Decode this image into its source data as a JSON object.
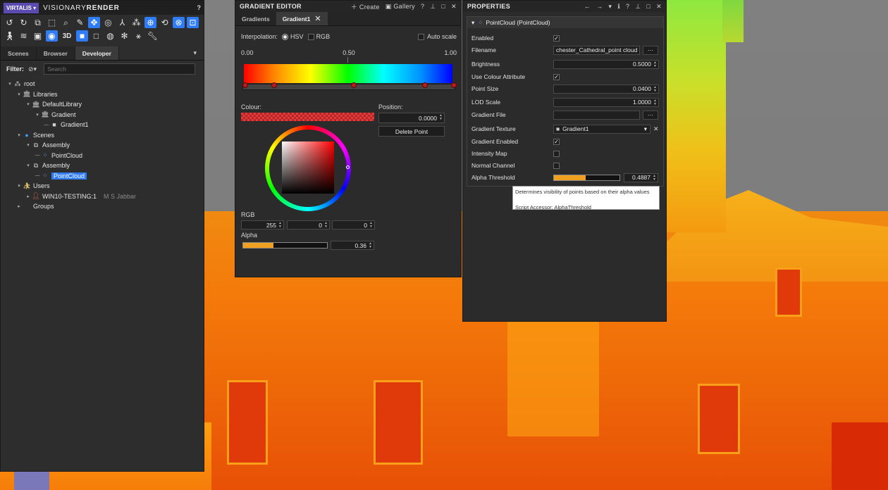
{
  "app": {
    "logo": "VIRTALIS",
    "name_light": "VISIONARY",
    "name_bold": "RENDER",
    "help": "?"
  },
  "left_panel": {
    "toolbar_row1": [
      "undo-icon",
      "redo-icon",
      "copy-icon",
      "select-icon",
      "zoom-icon",
      "edit-icon",
      "move-icon",
      "globe-icon",
      "axis-icon",
      "nodes-icon",
      "orbit-icon",
      "walk-icon",
      "magnet-icon",
      "snap-icon"
    ],
    "toolbar_row2": [
      "person-icon",
      "wifi-icon",
      "image-icon",
      "bulb-icon",
      "3d-toggle",
      "solid-icon",
      "wire-icon",
      "sphere-icon",
      "cog-icon",
      "pose-icon",
      "wrench-icon"
    ],
    "label_3d": "3D",
    "tabs": [
      {
        "label": "Scenes"
      },
      {
        "label": "Browser"
      },
      {
        "label": "Developer"
      }
    ],
    "tabs_more": "▾",
    "filter_label": "Filter:",
    "search_placeholder": "Search",
    "tree": [
      {
        "label": "root",
        "depth": 0,
        "icon": "root"
      },
      {
        "label": "Libraries",
        "depth": 1,
        "icon": "library"
      },
      {
        "label": "DefaultLibrary",
        "depth": 2,
        "icon": "library"
      },
      {
        "label": "Gradient",
        "depth": 3,
        "icon": "library"
      },
      {
        "label": "Gradient1",
        "depth": 4,
        "icon": "gradient"
      },
      {
        "label": "Scenes",
        "depth": 1,
        "icon": "scene"
      },
      {
        "label": "Assembly",
        "depth": 2,
        "icon": "assembly"
      },
      {
        "label": "PointCloud",
        "depth": 3,
        "icon": "pointcloud"
      },
      {
        "label": "Assembly",
        "depth": 2,
        "icon": "assembly"
      },
      {
        "label": "PointCloud",
        "depth": 3,
        "icon": "pointcloud",
        "selected": true
      },
      {
        "label": "Users",
        "depth": 1,
        "icon": "users"
      },
      {
        "label": "WIN10-TESTING:1",
        "depth": 2,
        "icon": "user",
        "sub": "M S Jabbar"
      },
      {
        "label": "Groups",
        "depth": 1,
        "icon": "groups"
      }
    ]
  },
  "gradient_editor": {
    "title": "GRADIENT EDITOR",
    "create": "Create",
    "gallery": "Gallery",
    "tabs": [
      "Gradients",
      "Gradient1"
    ],
    "interpolation_label": "Interpolation:",
    "hsv": "HSV",
    "rgb": "RGB",
    "auto_scale": "Auto scale",
    "scale": [
      "0.00",
      "0.50",
      "1.00"
    ],
    "stops": [
      0.0,
      0.14,
      0.52,
      0.86,
      1.0
    ],
    "colour_label": "Colour:",
    "position_label": "Position:",
    "position_value": "0.0000",
    "delete_point": "Delete Point",
    "rgb_label": "RGB",
    "rgb_values": [
      "255",
      "0",
      "0"
    ],
    "alpha_label": "Alpha",
    "alpha_value": "0.36",
    "alpha_fraction": 0.36
  },
  "properties": {
    "title": "PROPERTIES",
    "section": "PointCloud (PointCloud)",
    "rows": [
      {
        "name": "Enabled",
        "type": "check",
        "checked": true
      },
      {
        "name": "Filename",
        "type": "file",
        "value": "chester_Cathedral_point cloud"
      },
      {
        "name": "Brightness",
        "type": "number",
        "value": "0.5000"
      },
      {
        "name": "Use Colour Attribute",
        "type": "check",
        "checked": true
      },
      {
        "name": "Point Size",
        "type": "number",
        "value": "0.0400"
      },
      {
        "name": "LOD Scale",
        "type": "number",
        "value": "1.0000"
      },
      {
        "name": "Gradient File",
        "type": "file",
        "value": ""
      },
      {
        "name": "Gradient Texture",
        "type": "select",
        "value": "Gradient1"
      },
      {
        "name": "Gradient Enabled",
        "type": "check",
        "checked": true
      },
      {
        "name": "Intensity Map",
        "type": "check",
        "checked": false
      },
      {
        "name": "Normal Channel",
        "type": "check",
        "checked": false
      },
      {
        "name": "Alpha Threshold",
        "type": "slider",
        "value": "0.4887",
        "fraction": 0.4887
      }
    ],
    "browse": "···",
    "tooltip_line1": "Determines visibility of points based on their alpha values",
    "tooltip_line2": "Script Accessor: AlphaThreshold"
  },
  "colors": {
    "accent": "#2f7cf6",
    "panel": "#2b2b2b",
    "slider_fill": "#f0a020"
  }
}
